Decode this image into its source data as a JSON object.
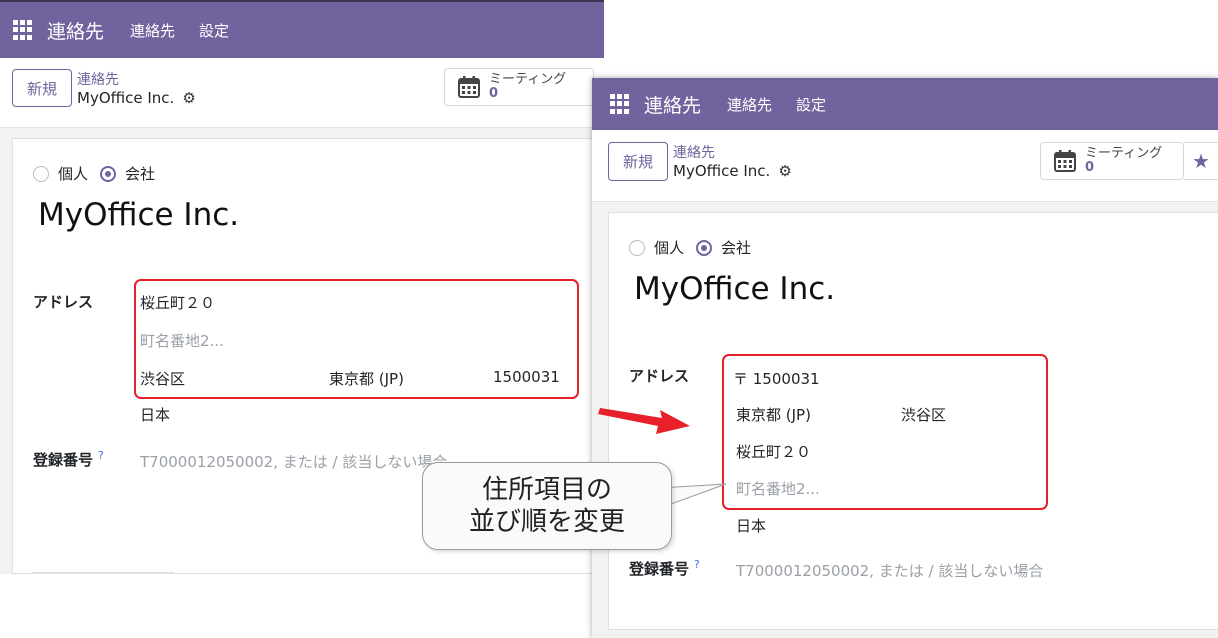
{
  "nav": {
    "brand": "連絡先",
    "items": [
      "連絡先",
      "設定"
    ]
  },
  "control_panel": {
    "new_button": "新規",
    "breadcrumb_parent": "連絡先",
    "breadcrumb_current": "MyOffice Inc.",
    "smart_button": {
      "label": "ミーティング",
      "value": "0"
    }
  },
  "form": {
    "radio_options": [
      "個人",
      "会社"
    ],
    "selected_type": "会社",
    "company_name": "MyOffice Inc.",
    "address_label": "アドレス",
    "registration_label": "登録番号",
    "registration_help": "?",
    "registration_placeholder": "T7000012050002, または / 該当しない場合"
  },
  "before": {
    "street": "桜丘町２０",
    "street2_placeholder": "町名番地2...",
    "city": "渋谷区",
    "state": "東京都 (JP)",
    "zip": "1500031",
    "country": "日本"
  },
  "after": {
    "zip_line": "〒 1500031",
    "state": "東京都 (JP)",
    "city": "渋谷区",
    "street": "桜丘町２０",
    "street2_placeholder": "町名番地2...",
    "country": "日本"
  },
  "callout": {
    "line1": "住所項目の",
    "line2": "並び順を変更"
  },
  "colors": {
    "brand": "#71639e",
    "highlight": "#e8202a"
  },
  "icons": [
    "apps-grid-icon",
    "gear-icon",
    "calendar-icon",
    "star-icon"
  ]
}
